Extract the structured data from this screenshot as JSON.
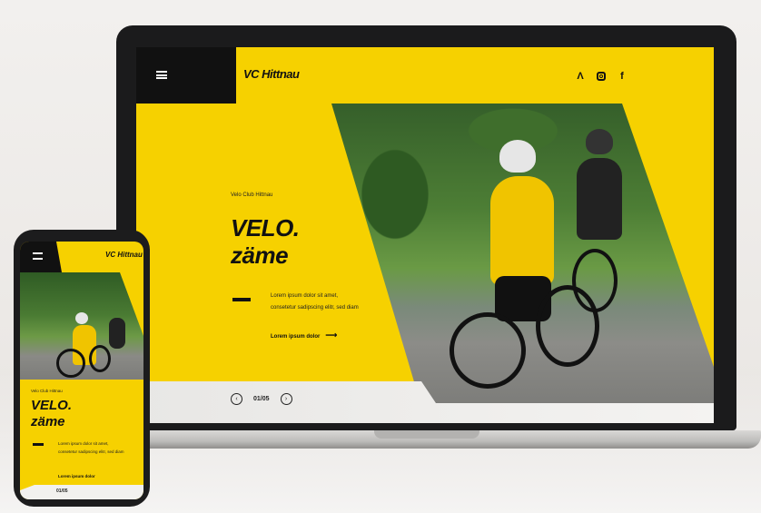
{
  "site": {
    "tagline": "Velo Club Hittnau",
    "title_line1": "VELO.",
    "title_line2": "zäme",
    "blurb": "Lorem ipsum dolor sit amet, consetetur sadipscing elitr, sed diam",
    "cta_label": "Lorem ipsum dolor",
    "pager": "01/05",
    "logo_text": "VC Hittnau",
    "logo_mark": "❧"
  },
  "socials": [
    {
      "icon": "strava-icon",
      "glyph": "Λ"
    },
    {
      "icon": "instagram-icon",
      "glyph": ""
    },
    {
      "icon": "facebook-icon",
      "glyph": "f"
    }
  ],
  "colors": {
    "brand_yellow": "#f6d100",
    "black": "#111111"
  },
  "glyphs": {
    "arrow": "⟶",
    "prev": "‹",
    "next": "›"
  }
}
